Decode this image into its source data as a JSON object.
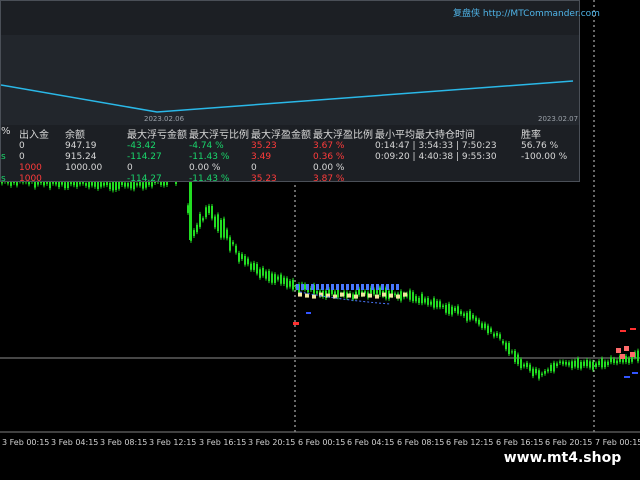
{
  "overlay": {
    "title": "复盘侠 http://MTCommander.com",
    "date_left": "2023.02.06",
    "date_right": "2023.02.07",
    "headers": [
      "%",
      "出入金",
      "余额",
      "最大浮亏金额",
      "最大浮亏比例",
      "最大浮盈金额",
      "最大浮盈比例",
      "最小平均最大持仓时间",
      "胜率"
    ],
    "rows": [
      {
        "pct": "",
        "deposit": "0",
        "deposit_color": "white",
        "balance": "947.19",
        "max_dd_amt": "-43.42",
        "max_dd_pct": "-4.74 %",
        "max_fp_amt": "35.23",
        "max_fp_pct": "3.67 %",
        "hold_time": "0:14:47 | 3:54:33 | 7:50:23",
        "winrate": "56.76 %"
      },
      {
        "pct": "s",
        "deposit": "0",
        "deposit_color": "white",
        "balance": "915.24",
        "max_dd_amt": "-114.27",
        "max_dd_pct": "-11.43 %",
        "max_fp_amt": "3.49",
        "max_fp_pct": "0.36 %",
        "hold_time": "0:09:20 | 4:40:38 | 9:55:30",
        "winrate": "-100.00 %"
      },
      {
        "pct": "",
        "deposit": "1000",
        "deposit_color": "red",
        "balance": "1000.00",
        "max_dd_amt": "0",
        "max_dd_pct": "0.00 %",
        "max_fp_amt": "0",
        "max_fp_pct": "0.00 %",
        "hold_time": "",
        "winrate": ""
      },
      {
        "pct": "s",
        "deposit": "1000",
        "deposit_color": "red",
        "balance": "",
        "max_dd_amt": "-114.27",
        "max_dd_pct": "-11.43 %",
        "max_fp_amt": "35.23",
        "max_fp_pct": "3.87 %",
        "hold_time": "",
        "winrate": ""
      }
    ]
  },
  "x_axis_labels": [
    "3 Feb 00:15",
    "3 Feb 04:15",
    "3 Feb 08:15",
    "3 Feb 12:15",
    "3 Feb 16:15",
    "3 Feb 20:15",
    "6 Feb 00:15",
    "6 Feb 04:15",
    "6 Feb 08:15",
    "6 Feb 12:15",
    "6 Feb 16:15",
    "6 Feb 20:15",
    "7 Feb 00:15"
  ],
  "watermark": "www.mt4.shop",
  "colors": {
    "background": "#000000",
    "bull_candle": "#22dd22",
    "equity_line": "#2ab8e8",
    "grid_line": "#a0a0a0",
    "positive": "#19d66b",
    "negative": "#ff3b3b"
  }
}
